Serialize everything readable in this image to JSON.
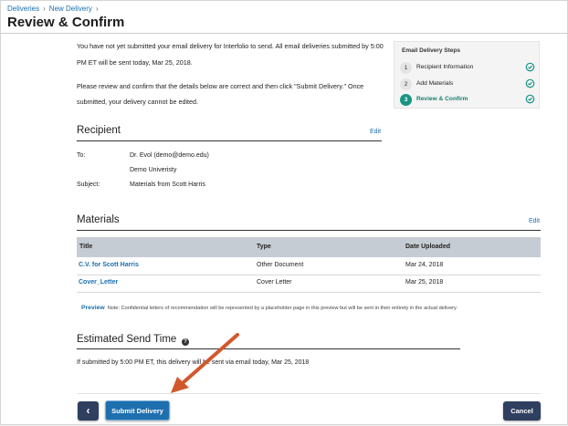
{
  "breadcrumb": {
    "items": [
      "Deliveries",
      "New Delivery"
    ],
    "separator": "›"
  },
  "page_title": "Review & Confirm",
  "intro": {
    "line1": "You have not yet submitted your email delivery for Interfolio to send. All email deliveries submitted by 5:00",
    "line2": "PM ET will be sent today, Mar 25, 2018.",
    "line3": "Please review and confirm that the details below are correct and then click \"Submit Delivery.\" Once",
    "line4": "submitted, your delivery cannot be edited."
  },
  "steps": {
    "title": "Email Delivery Steps",
    "items": [
      {
        "num": "1",
        "label": "Recipient Information",
        "done": true
      },
      {
        "num": "2",
        "label": "Add Materials",
        "done": true
      },
      {
        "num": "3",
        "label": "Review & Confirm",
        "done": true,
        "active": true
      }
    ]
  },
  "recipient": {
    "title": "Recipient",
    "edit": "Edit",
    "to_label": "To:",
    "to_value": "Dr. Evol (demo@demo.edu)",
    "institution": "Demo Univeristy",
    "subject_label": "Subject:",
    "subject_value": "Materials from Scott Harris"
  },
  "materials": {
    "title": "Materials",
    "edit": "Edit",
    "columns": [
      "Title",
      "Type",
      "Date Uploaded"
    ],
    "rows": [
      [
        "C.V. for Scott Harris",
        "Other Document",
        "Mar 24, 2018"
      ],
      [
        "Cover_Letter",
        "Cover Letter",
        "Mar 25, 2018"
      ]
    ],
    "preview_label": "Preview",
    "preview_note": "Note: Confidential letters of recommendation will be represented by a placeholder page in this preview but will be sent in their entirety in the actual delivery."
  },
  "send_time": {
    "title": "Estimated Send Time",
    "help": "?",
    "text": "If submitted by 5:00 PM ET, this delivery will be sent via email today, Mar 25, 2018"
  },
  "footer": {
    "back_icon": "‹",
    "submit": "Submit Delivery",
    "cancel": "Cancel"
  },
  "colors": {
    "accent": "#1e6fae",
    "step_active": "#1a9583",
    "dark_button": "#2f3f60",
    "arrow": "#d2582c"
  }
}
